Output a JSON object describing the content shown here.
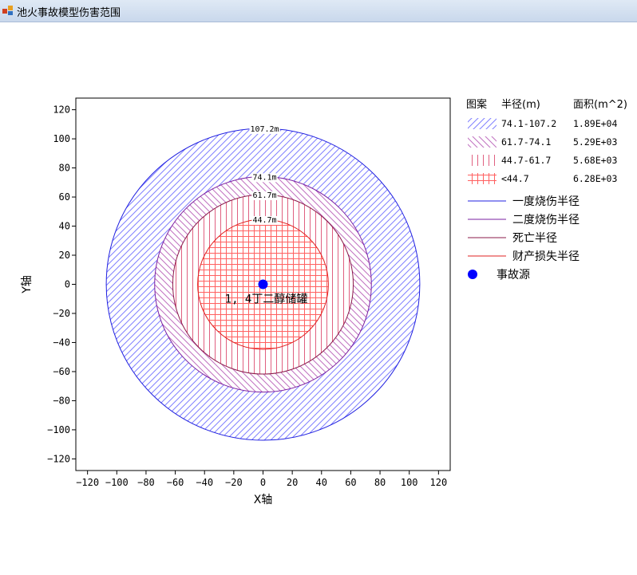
{
  "window": {
    "title": "池火事故模型伤害范围"
  },
  "chart_data": {
    "type": "scatter",
    "xlabel": "X轴",
    "ylabel": "Y轴",
    "xlim": [
      -128,
      128
    ],
    "ylim": [
      -128,
      128
    ],
    "xticks": [
      -120,
      -100,
      -80,
      -60,
      -40,
      -20,
      0,
      20,
      40,
      60,
      80,
      100,
      120
    ],
    "yticks": [
      -120,
      -100,
      -80,
      -60,
      -40,
      -20,
      0,
      20,
      40,
      60,
      80,
      100,
      120
    ],
    "grid": false,
    "legend_position": "right",
    "zones": [
      {
        "outer": 107.2,
        "inner": 74.1,
        "pattern": "diagonal",
        "color": "#8080ff",
        "range_label": "74.1-107.2",
        "area": "1.89E+04"
      },
      {
        "outer": 74.1,
        "inner": 61.7,
        "pattern": "backdiagonal",
        "color": "#c070c0",
        "range_label": "61.7-74.1",
        "area": "5.29E+03"
      },
      {
        "outer": 61.7,
        "inner": 44.7,
        "pattern": "vertical",
        "color": "#e06080",
        "range_label": "44.7-61.7",
        "area": "5.68E+03"
      },
      {
        "outer": 44.7,
        "inner": 0,
        "pattern": "grid",
        "color": "#ff6060",
        "range_label": "<44.7",
        "area": "6.28E+03"
      }
    ],
    "circles": [
      {
        "radius": 107.2,
        "label": "107.2m",
        "color": "#2020e0",
        "legend": "一度烧伤半径"
      },
      {
        "radius": 74.1,
        "label": "74.1m",
        "color": "#7a1fa2",
        "legend": "二度烧伤半径"
      },
      {
        "radius": 61.7,
        "label": "61.7m",
        "color": "#8b1a4a",
        "legend": "死亡半径"
      },
      {
        "radius": 44.7,
        "label": "44.7m",
        "color": "#e02020",
        "legend": "财产损失半径"
      }
    ],
    "source": {
      "x": 0,
      "y": 0,
      "label": "1, 4丁二醇储罐",
      "legend": "事故源",
      "color": "#0000ff"
    },
    "legend_headers": {
      "pattern": "图案",
      "radius": "半径(m)",
      "area": "面积(m^2)"
    }
  }
}
